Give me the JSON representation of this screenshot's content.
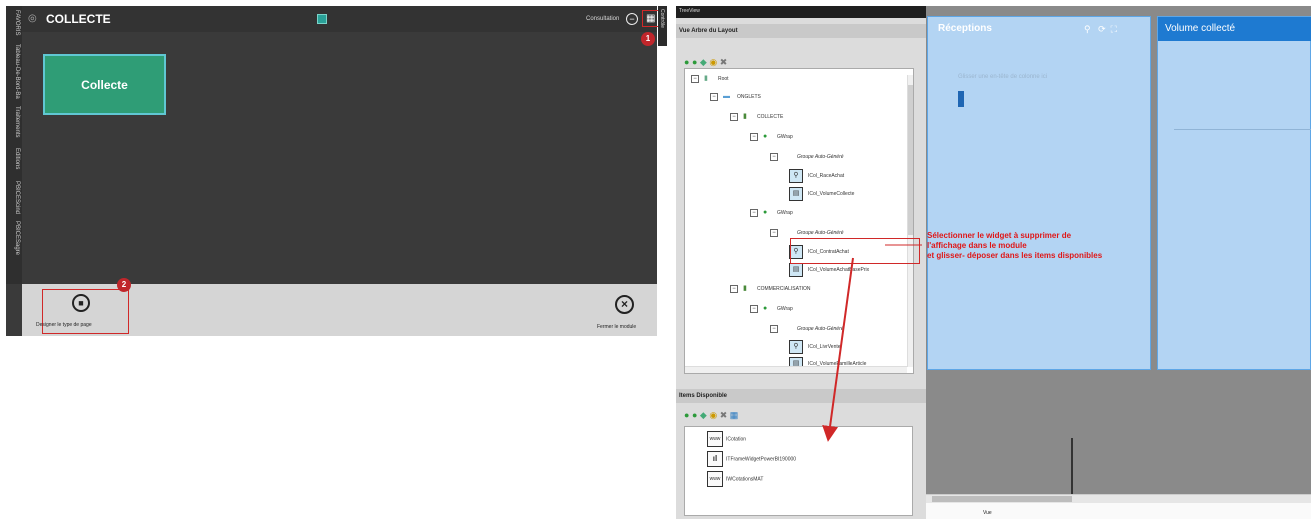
{
  "module": {
    "title": "COLLECTE",
    "tile_label": "Collecte",
    "consultation_label": "Consultation",
    "controls_label": "Contrôle",
    "badge_1": "1",
    "badge_2": "2",
    "designer_label": "Designer le type de page",
    "close_label": "Fermer le module",
    "side_tabs": [
      "FAVORIS",
      "Tableau-De-Bord-Ba",
      "Traitements",
      "Editions",
      "PBICEScind",
      "PBICESagre"
    ]
  },
  "tree": {
    "topbar_label": "TreeView",
    "header": "Vue Arbre du Layout",
    "nodes": [
      {
        "label": "Root"
      },
      {
        "label": "ONGLETS"
      },
      {
        "label": "COLLECTE"
      },
      {
        "label": "GWrap"
      },
      {
        "label": "Groupe Auto-Généré"
      },
      {
        "label": "ICol_RaceAchat"
      },
      {
        "label": "ICol_VolumeCollecte"
      },
      {
        "label": "GWrap"
      },
      {
        "label": "Groupe Auto-Généré"
      },
      {
        "label": "ICol_ContratAchat"
      },
      {
        "label": "ICol_VolumeAchatBasePrix"
      },
      {
        "label": "COMMERCIALISATION"
      },
      {
        "label": "GWrap"
      },
      {
        "label": "Groupe Auto-Généré"
      },
      {
        "label": "ICol_LivrVente"
      },
      {
        "label": "ICol_VolumeFamilleArticle"
      }
    ],
    "items_header": "Items Disponible",
    "items": [
      {
        "icon": "www",
        "label": "ICotation"
      },
      {
        "icon": "bars",
        "label": "ITFrameWidgetPowerBI190000"
      },
      {
        "icon": "www",
        "label": "IWCotationsMAT"
      }
    ]
  },
  "preview": {
    "receptions_title": "Réceptions",
    "group_hint": "Glisser une en-tête de colonne ici",
    "volume_title": "Volume collecté",
    "vue_label": "Vue"
  },
  "instruction_lines": [
    "Sélectionner le widget à supprimer de",
    "l'affichage dans le module",
    "et glisser- déposer dans les items disponibles"
  ],
  "colors": {
    "annotation_red": "#d02828",
    "tile_green": "#2f9d76",
    "card_blue": "#b3d4f3",
    "header_blue": "#1e7ad1"
  }
}
